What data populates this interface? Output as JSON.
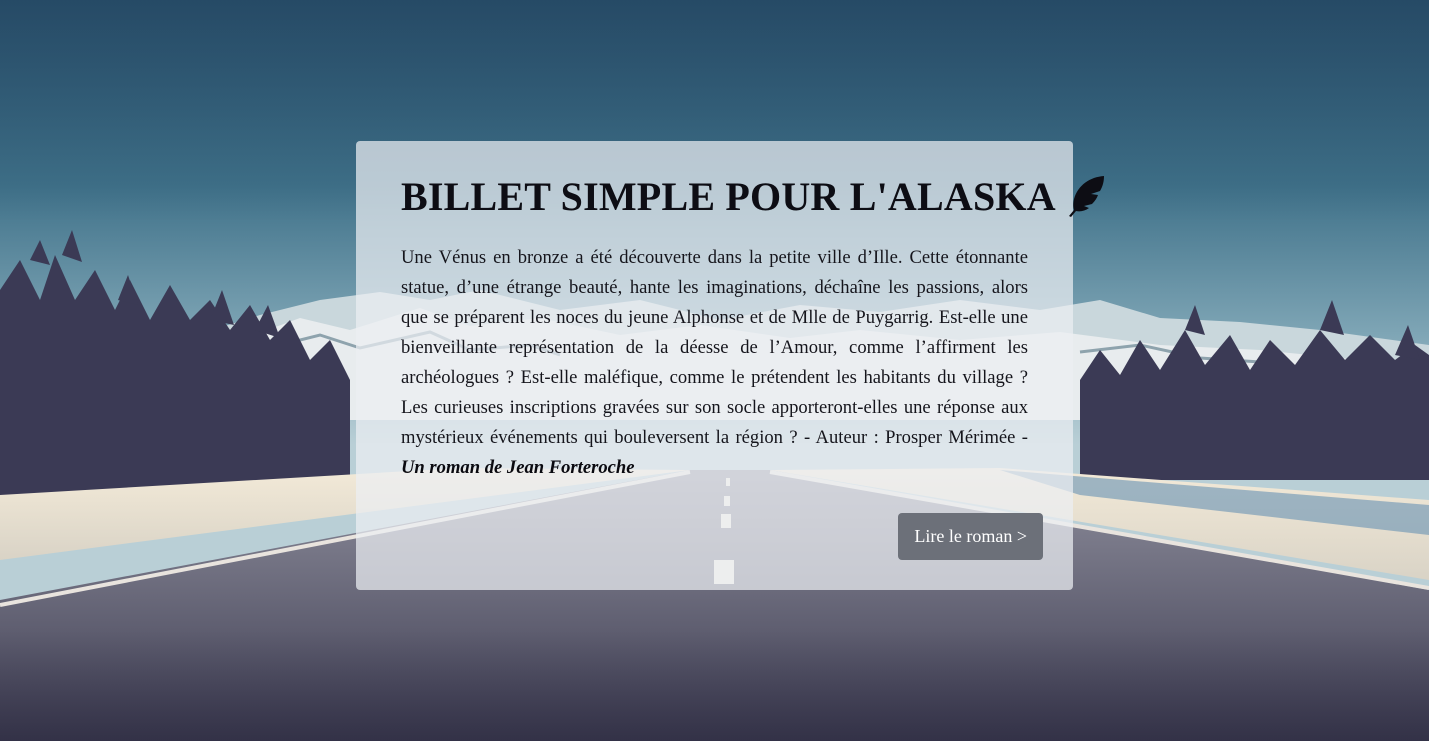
{
  "hero": {
    "title": "BILLET SIMPLE POUR L'ALASKA",
    "title_icon": "feather-icon",
    "synopsis": "Une Vénus en bronze a été découverte dans la petite ville d’Ille. Cette étonnante statue, d’une étrange beauté, hante les imaginations, déchaîne les passions, alors que se préparent les noces du jeune Alphonse et de Mlle de Puygarrig. Est-elle une bienveillante représentation de la déesse de l’Amour, comme l’affirment les archéologues ? Est-elle maléfique, comme le prétendent les habitants du village ? Les curieuses inscriptions gravées sur son socle apporteront-elles une réponse aux mystérieux événements qui bouleversent la région ? - Auteur : Prosper Mérimée - ",
    "byline": "Un roman de Jean Forteroche",
    "button_label": "Lire le roman >"
  },
  "colors": {
    "sky_top": "#2e5a78",
    "sky_bottom": "#a9c6d2",
    "card_bg": "#ebeef2",
    "button_bg": "#6c7079",
    "title_text": "#0d0d14"
  },
  "background": {
    "image": "alaska-road-forest-mountains"
  }
}
